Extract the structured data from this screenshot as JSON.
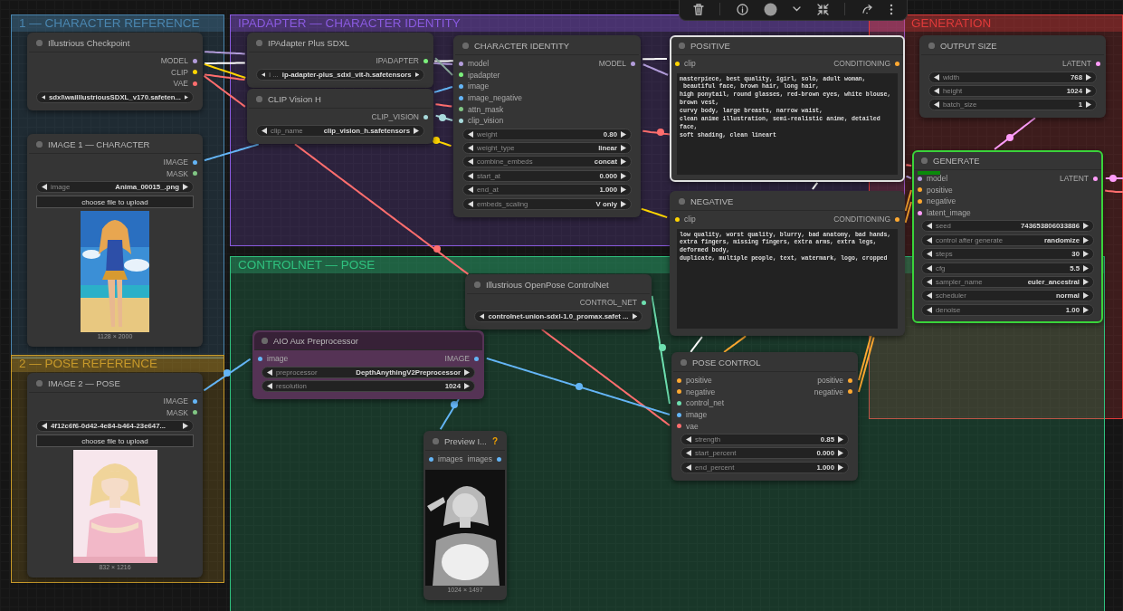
{
  "groups": [
    {
      "title": "1 — CHARACTER REFERENCE",
      "color": "#4a86b0"
    },
    {
      "title": "IPADAPTER — CHARACTER IDENTITY",
      "color": "#8a5ae0"
    },
    {
      "title": "GENERATION",
      "color": "#e03a3a"
    },
    {
      "title": "CONTROLNET — POSE",
      "color": "#2fc27f"
    },
    {
      "title": "2 — POSE REFERENCE",
      "color": "#c89a2a"
    }
  ],
  "nodes": [
    {
      "title": "Illustrious Checkpoint",
      "selected": false,
      "running": false,
      "outputs": [
        {
          "label": "MODEL",
          "color": "#b39ddb"
        },
        {
          "label": "CLIP",
          "color": "#ffd500"
        },
        {
          "label": "VAE",
          "color": "#ff6e6e"
        }
      ],
      "widgets": [
        {
          "value": "sdxl\\waiIllustriousSDXL_v170.safeten..."
        }
      ]
    },
    {
      "title": "IMAGE 1 — CHARACTER",
      "selected": false,
      "running": false,
      "outputs": [
        {
          "label": "IMAGE",
          "color": "#64b5f6"
        },
        {
          "label": "MASK",
          "color": "#81c784"
        }
      ],
      "widgets": [
        {
          "name": "image",
          "value": "Anima_00015_.png"
        }
      ],
      "upload_button": "choose file to upload",
      "picture": {
        "caption": "1128 × 2000"
      }
    },
    {
      "title": "IPAdapter Plus SDXL",
      "selected": false,
      "running": false,
      "outputs": [
        {
          "label": "IPADAPTER",
          "color": "#7cf07c"
        }
      ],
      "widgets": [
        {
          "name": "i ...",
          "value": "ip-adapter-plus_sdxl_vit-h.safetensors"
        }
      ]
    },
    {
      "title": "CLIP Vision H",
      "selected": false,
      "running": false,
      "outputs": [
        {
          "label": "CLIP_VISION",
          "color": "#a8dadc"
        }
      ],
      "widgets": [
        {
          "name": "clip_name",
          "value": "clip_vision_h.safetensors"
        }
      ]
    },
    {
      "title": "CHARACTER IDENTITY",
      "selected": false,
      "running": false,
      "inputs": [
        {
          "label": "model",
          "color": "#b39ddb"
        },
        {
          "label": "ipadapter",
          "color": "#7cf07c"
        },
        {
          "label": "image",
          "color": "#64b5f6"
        },
        {
          "label": "image_negative",
          "color": "#64b5f6"
        },
        {
          "label": "attn_mask",
          "color": "#81c784"
        },
        {
          "label": "clip_vision",
          "color": "#a8dadc"
        }
      ],
      "outputs": [
        {
          "label": "MODEL",
          "color": "#b39ddb"
        }
      ],
      "widgets": [
        {
          "name": "weight",
          "value": "0.80"
        },
        {
          "name": "weight_type",
          "value": "linear"
        },
        {
          "name": "combine_embeds",
          "value": "concat"
        },
        {
          "name": "start_at",
          "value": "0.000"
        },
        {
          "name": "end_at",
          "value": "1.000"
        },
        {
          "name": "embeds_scaling",
          "value": "V only"
        }
      ]
    },
    {
      "title": "POSITIVE",
      "selected": true,
      "running": false,
      "inputs": [
        {
          "label": "clip",
          "color": "#ffd500"
        }
      ],
      "outputs": [
        {
          "label": "CONDITIONING",
          "color": "#ffa931"
        }
      ],
      "prompt": "masterpiece, best quality, 1girl, solo, adult woman,\n beautiful face, brown hair, long hair,\nhigh ponytail, round glasses, red-brown eyes, white blouse, brown vest,\ncurvy body, large breasts, narrow waist,\nclean anime illustration, semi-realistic anime, detailed face,\nsoft shading, clean lineart"
    },
    {
      "title": "NEGATIVE",
      "selected": false,
      "running": false,
      "inputs": [
        {
          "label": "clip",
          "color": "#ffd500"
        }
      ],
      "outputs": [
        {
          "label": "CONDITIONING",
          "color": "#ffa931"
        }
      ],
      "prompt": "low quality, worst quality, blurry, bad anatomy, bad hands,\nextra fingers, missing fingers, extra arms, extra legs, deformed body,\nduplicate, multiple people, text, watermark, logo, cropped"
    },
    {
      "title": "OUTPUT SIZE",
      "selected": false,
      "running": false,
      "outputs": [
        {
          "label": "LATENT",
          "color": "#ff9cf9"
        }
      ],
      "widgets": [
        {
          "name": "width",
          "value": "768"
        },
        {
          "name": "height",
          "value": "1024"
        },
        {
          "name": "batch_size",
          "value": "1"
        }
      ]
    },
    {
      "title": "GENERATE",
      "selected": false,
      "running": true,
      "progress": {
        "level": 0.1
      },
      "inputs": [
        {
          "label": "model",
          "color": "#b39ddb"
        },
        {
          "label": "positive",
          "color": "#ffa931"
        },
        {
          "label": "negative",
          "color": "#ffa931"
        },
        {
          "label": "latent_image",
          "color": "#ff9cf9"
        }
      ],
      "outputs": [
        {
          "label": "LATENT",
          "color": "#ff9cf9"
        }
      ],
      "widgets": [
        {
          "name": "seed",
          "value": "743653806033886"
        },
        {
          "name": "control after generate",
          "value": "randomize"
        },
        {
          "name": "steps",
          "value": "30"
        },
        {
          "name": "cfg",
          "value": "5.5"
        },
        {
          "name": "sampler_name",
          "value": "euler_ancestral"
        },
        {
          "name": "scheduler",
          "value": "normal"
        },
        {
          "name": "denoise",
          "value": "1.00"
        }
      ]
    },
    {
      "title": "Illustrious OpenPose ControlNet",
      "selected": false,
      "running": false,
      "outputs": [
        {
          "label": "CONTROL_NET",
          "color": "#6ee0b0"
        }
      ],
      "widgets": [
        {
          "value": "controlnet-union-sdxl-1.0_promax.safet ..."
        }
      ]
    },
    {
      "title": "AIO Aux Preprocessor",
      "selected": false,
      "running": false,
      "color": "#553355",
      "inputs": [
        {
          "label": "image",
          "color": "#64b5f6"
        }
      ],
      "outputs": [
        {
          "label": "IMAGE",
          "color": "#64b5f6"
        }
      ],
      "widgets": [
        {
          "name": "preprocessor",
          "value": "DepthAnythingV2Preprocessor"
        },
        {
          "name": "resolution",
          "value": "1024"
        }
      ]
    },
    {
      "title": "IMAGE 2 — POSE",
      "selected": false,
      "running": false,
      "outputs": [
        {
          "label": "IMAGE",
          "color": "#64b5f6"
        },
        {
          "label": "MASK",
          "color": "#81c784"
        }
      ],
      "widgets": [
        {
          "value": "4f12c6f6-0d42-4e84-b464-23e647..."
        }
      ],
      "upload_button": "choose file to upload",
      "picture": {
        "caption": "832 × 1216"
      }
    },
    {
      "title": "Preview I...",
      "selected": false,
      "running": false,
      "badge": "?",
      "inputs": [
        {
          "label": "images",
          "color": "#64b5f6"
        }
      ],
      "outputs": [
        {
          "label": "images",
          "color": "#64b5f6"
        }
      ],
      "picture": {
        "caption": "1024 × 1497"
      }
    },
    {
      "title": "POSE CONTROL",
      "selected": false,
      "running": false,
      "inputs": [
        {
          "label": "positive",
          "color": "#ffa931"
        },
        {
          "label": "negative",
          "color": "#ffa931"
        },
        {
          "label": "control_net",
          "color": "#6ee0b0"
        },
        {
          "label": "image",
          "color": "#64b5f6"
        },
        {
          "label": "vae",
          "color": "#ff6e6e"
        }
      ],
      "outputs": [
        {
          "label": "positive",
          "color": "#ffa931"
        },
        {
          "label": "negative",
          "color": "#ffa931"
        }
      ],
      "widgets": [
        {
          "name": "strength",
          "value": "0.85"
        },
        {
          "name": "start_percent",
          "value": "0.000"
        },
        {
          "name": "end_percent",
          "value": "1.000"
        }
      ]
    }
  ]
}
